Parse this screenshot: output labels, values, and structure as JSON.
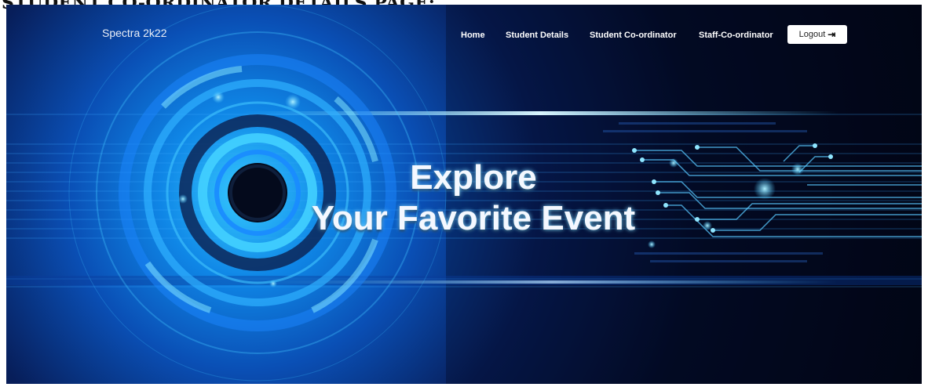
{
  "document": {
    "heading": "STUDENT CO-ORDINATOR DETAILS PAGE:"
  },
  "navbar": {
    "brand": "Spectra 2k22",
    "links": [
      "Home",
      "Student Details",
      "Student Co-ordinator",
      "Staff-Co-ordinator"
    ],
    "logout_label": "Logout",
    "logout_icon": "logout-icon"
  },
  "hero": {
    "line1": "Explore",
    "line2": "Your Favorite Event"
  },
  "colors": {
    "accent": "#1ea7ff",
    "background": "#020a22",
    "button_bg": "#ffffff"
  }
}
